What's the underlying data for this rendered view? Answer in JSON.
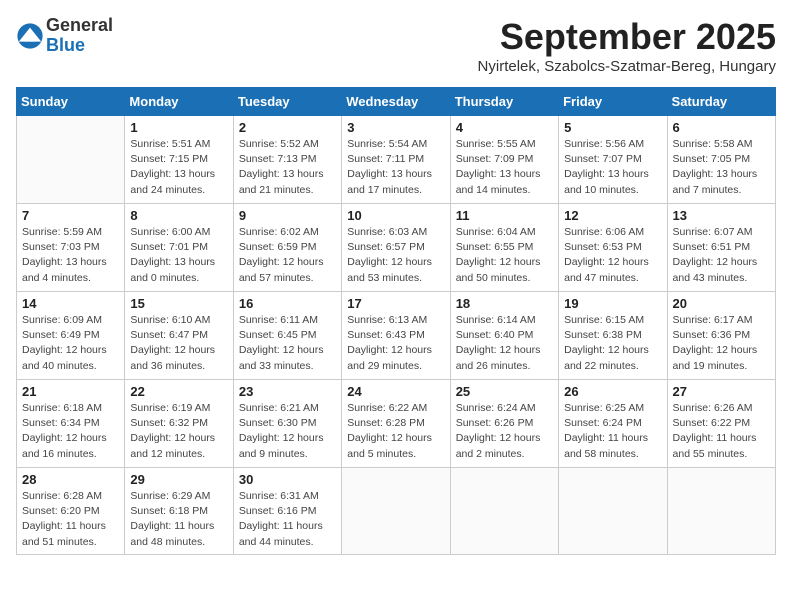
{
  "header": {
    "logo_line1": "General",
    "logo_line2": "Blue",
    "month_title": "September 2025",
    "location": "Nyirtelek, Szabolcs-Szatmar-Bereg, Hungary"
  },
  "weekdays": [
    "Sunday",
    "Monday",
    "Tuesday",
    "Wednesday",
    "Thursday",
    "Friday",
    "Saturday"
  ],
  "weeks": [
    [
      {
        "day": "",
        "info": ""
      },
      {
        "day": "1",
        "info": "Sunrise: 5:51 AM\nSunset: 7:15 PM\nDaylight: 13 hours\nand 24 minutes."
      },
      {
        "day": "2",
        "info": "Sunrise: 5:52 AM\nSunset: 7:13 PM\nDaylight: 13 hours\nand 21 minutes."
      },
      {
        "day": "3",
        "info": "Sunrise: 5:54 AM\nSunset: 7:11 PM\nDaylight: 13 hours\nand 17 minutes."
      },
      {
        "day": "4",
        "info": "Sunrise: 5:55 AM\nSunset: 7:09 PM\nDaylight: 13 hours\nand 14 minutes."
      },
      {
        "day": "5",
        "info": "Sunrise: 5:56 AM\nSunset: 7:07 PM\nDaylight: 13 hours\nand 10 minutes."
      },
      {
        "day": "6",
        "info": "Sunrise: 5:58 AM\nSunset: 7:05 PM\nDaylight: 13 hours\nand 7 minutes."
      }
    ],
    [
      {
        "day": "7",
        "info": "Sunrise: 5:59 AM\nSunset: 7:03 PM\nDaylight: 13 hours\nand 4 minutes."
      },
      {
        "day": "8",
        "info": "Sunrise: 6:00 AM\nSunset: 7:01 PM\nDaylight: 13 hours\nand 0 minutes."
      },
      {
        "day": "9",
        "info": "Sunrise: 6:02 AM\nSunset: 6:59 PM\nDaylight: 12 hours\nand 57 minutes."
      },
      {
        "day": "10",
        "info": "Sunrise: 6:03 AM\nSunset: 6:57 PM\nDaylight: 12 hours\nand 53 minutes."
      },
      {
        "day": "11",
        "info": "Sunrise: 6:04 AM\nSunset: 6:55 PM\nDaylight: 12 hours\nand 50 minutes."
      },
      {
        "day": "12",
        "info": "Sunrise: 6:06 AM\nSunset: 6:53 PM\nDaylight: 12 hours\nand 47 minutes."
      },
      {
        "day": "13",
        "info": "Sunrise: 6:07 AM\nSunset: 6:51 PM\nDaylight: 12 hours\nand 43 minutes."
      }
    ],
    [
      {
        "day": "14",
        "info": "Sunrise: 6:09 AM\nSunset: 6:49 PM\nDaylight: 12 hours\nand 40 minutes."
      },
      {
        "day": "15",
        "info": "Sunrise: 6:10 AM\nSunset: 6:47 PM\nDaylight: 12 hours\nand 36 minutes."
      },
      {
        "day": "16",
        "info": "Sunrise: 6:11 AM\nSunset: 6:45 PM\nDaylight: 12 hours\nand 33 minutes."
      },
      {
        "day": "17",
        "info": "Sunrise: 6:13 AM\nSunset: 6:43 PM\nDaylight: 12 hours\nand 29 minutes."
      },
      {
        "day": "18",
        "info": "Sunrise: 6:14 AM\nSunset: 6:40 PM\nDaylight: 12 hours\nand 26 minutes."
      },
      {
        "day": "19",
        "info": "Sunrise: 6:15 AM\nSunset: 6:38 PM\nDaylight: 12 hours\nand 22 minutes."
      },
      {
        "day": "20",
        "info": "Sunrise: 6:17 AM\nSunset: 6:36 PM\nDaylight: 12 hours\nand 19 minutes."
      }
    ],
    [
      {
        "day": "21",
        "info": "Sunrise: 6:18 AM\nSunset: 6:34 PM\nDaylight: 12 hours\nand 16 minutes."
      },
      {
        "day": "22",
        "info": "Sunrise: 6:19 AM\nSunset: 6:32 PM\nDaylight: 12 hours\nand 12 minutes."
      },
      {
        "day": "23",
        "info": "Sunrise: 6:21 AM\nSunset: 6:30 PM\nDaylight: 12 hours\nand 9 minutes."
      },
      {
        "day": "24",
        "info": "Sunrise: 6:22 AM\nSunset: 6:28 PM\nDaylight: 12 hours\nand 5 minutes."
      },
      {
        "day": "25",
        "info": "Sunrise: 6:24 AM\nSunset: 6:26 PM\nDaylight: 12 hours\nand 2 minutes."
      },
      {
        "day": "26",
        "info": "Sunrise: 6:25 AM\nSunset: 6:24 PM\nDaylight: 11 hours\nand 58 minutes."
      },
      {
        "day": "27",
        "info": "Sunrise: 6:26 AM\nSunset: 6:22 PM\nDaylight: 11 hours\nand 55 minutes."
      }
    ],
    [
      {
        "day": "28",
        "info": "Sunrise: 6:28 AM\nSunset: 6:20 PM\nDaylight: 11 hours\nand 51 minutes."
      },
      {
        "day": "29",
        "info": "Sunrise: 6:29 AM\nSunset: 6:18 PM\nDaylight: 11 hours\nand 48 minutes."
      },
      {
        "day": "30",
        "info": "Sunrise: 6:31 AM\nSunset: 6:16 PM\nDaylight: 11 hours\nand 44 minutes."
      },
      {
        "day": "",
        "info": ""
      },
      {
        "day": "",
        "info": ""
      },
      {
        "day": "",
        "info": ""
      },
      {
        "day": "",
        "info": ""
      }
    ]
  ]
}
